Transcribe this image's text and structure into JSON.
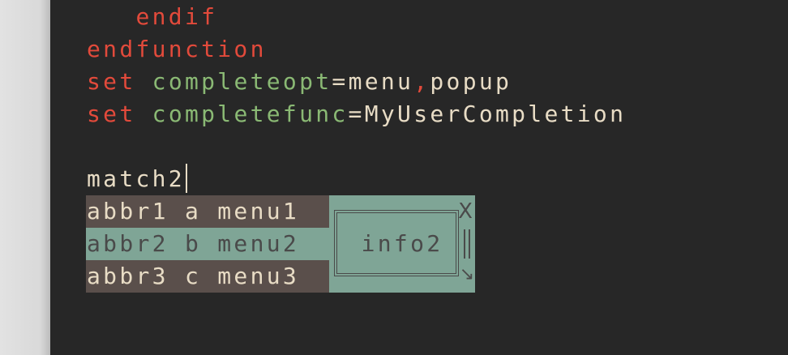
{
  "editor": {
    "lines": [
      {
        "indent": "   ",
        "keyword": "endif"
      },
      {
        "keyword": "endfunction"
      },
      {
        "keyword": "set",
        "option": "completeopt",
        "eq": "=",
        "value1": "menu",
        "comma": ",",
        "value2": "popup"
      },
      {
        "keyword": "set",
        "option": "completefunc",
        "eq": "=",
        "value": "MyUserCompletion"
      },
      {
        "text": ""
      },
      {
        "text": "match2"
      }
    ]
  },
  "completion_menu": {
    "items": [
      {
        "label": "abbr1 a menu1",
        "selected": false
      },
      {
        "label": "abbr2 b menu2",
        "selected": true
      },
      {
        "label": "abbr3 c menu3",
        "selected": false
      }
    ]
  },
  "info_popup": {
    "text": "info2",
    "close_glyph": "X",
    "resize_glyph": "↘",
    "close_icon": "close-icon",
    "resize_icon": "resize-icon"
  },
  "colors": {
    "background": "#272727",
    "keyword": "#e24a3b",
    "option": "#8ab974",
    "text": "#e8dcc5",
    "menu_bg": "#5a4f4b",
    "menu_selected_bg": "#7fa596"
  }
}
